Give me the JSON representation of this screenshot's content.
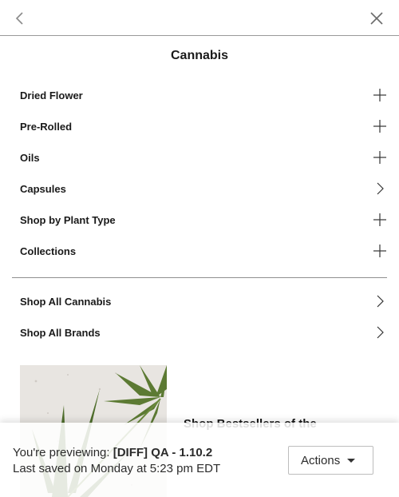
{
  "header": {
    "back_icon": "chevron-left-icon",
    "close_icon": "close-icon"
  },
  "title": "Cannabis",
  "menu": {
    "items": [
      {
        "label": "Dried Flower",
        "indicator": "plus-icon"
      },
      {
        "label": "Pre-Rolled",
        "indicator": "plus-icon"
      },
      {
        "label": "Oils",
        "indicator": "plus-icon"
      },
      {
        "label": "Capsules",
        "indicator": "chevron-right-icon"
      },
      {
        "label": "Shop by Plant Type",
        "indicator": "plus-icon"
      },
      {
        "label": "Collections",
        "indicator": "plus-icon"
      }
    ],
    "shop_links": [
      {
        "label": "Shop All Cannabis",
        "indicator": "chevron-right-icon"
      },
      {
        "label": "Shop All Brands",
        "indicator": "chevron-right-icon"
      }
    ]
  },
  "promo": {
    "text": "Shop Bestsellers of the",
    "image": "cannabis-leaves-image"
  },
  "preview": {
    "prefix": "You're previewing: ",
    "theme_name": "[DIFF] QA - 1.10.2",
    "saved": "Last saved on Monday at 5:23 pm EDT",
    "actions_label": "Actions",
    "actions_icon": "caret-down-icon"
  }
}
